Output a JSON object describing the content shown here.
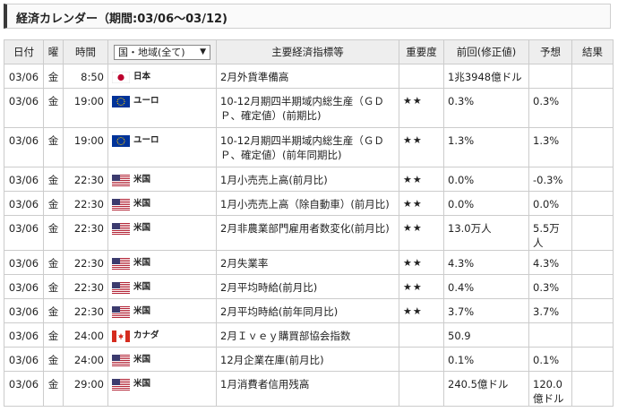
{
  "title": "経済カレンダー（期間:03/06〜03/12)",
  "headers": {
    "date": "日付",
    "day": "曜",
    "time": "時間",
    "region_select": "国・地域(全て)",
    "indicator": "主要経済指標等",
    "importance": "重要度",
    "previous": "前回(修正値)",
    "forecast": "予想",
    "result": "結果"
  },
  "rows": [
    {
      "date": "03/06",
      "day": "金",
      "time": "8:50",
      "flag": "jp-flag",
      "region": "日本",
      "indicator": "2月外貨準備高",
      "importance": "",
      "previous": "1兆3948億ドル",
      "forecast": "",
      "result": ""
    },
    {
      "date": "03/06",
      "day": "金",
      "time": "19:00",
      "flag": "eu-flag",
      "region": "ユーロ",
      "indicator": "10-12月期四半期域内総生産（ＧＤＰ、確定値）(前期比)",
      "importance": "★★",
      "previous": "0.3%",
      "forecast": "0.3%",
      "result": ""
    },
    {
      "date": "03/06",
      "day": "金",
      "time": "19:00",
      "flag": "eu-flag",
      "region": "ユーロ",
      "indicator": "10-12月期四半期域内総生産（ＧＤＰ、確定値）(前年同期比)",
      "importance": "★★",
      "previous": "1.3%",
      "forecast": "1.3%",
      "result": ""
    },
    {
      "date": "03/06",
      "day": "金",
      "time": "22:30",
      "flag": "us-flag",
      "region": "米国",
      "indicator": "1月小売売上高(前月比)",
      "importance": "★★",
      "previous": "0.0%",
      "forecast": "-0.3%",
      "result": ""
    },
    {
      "date": "03/06",
      "day": "金",
      "time": "22:30",
      "flag": "us-flag",
      "region": "米国",
      "indicator": "1月小売売上高（除自動車）(前月比)",
      "importance": "★★",
      "previous": "0.0%",
      "forecast": "0.0%",
      "result": ""
    },
    {
      "date": "03/06",
      "day": "金",
      "time": "22:30",
      "flag": "us-flag",
      "region": "米国",
      "indicator": "2月非農業部門雇用者数変化(前月比)",
      "importance": "★★",
      "previous": "13.0万人",
      "forecast": "5.5万人",
      "result": ""
    },
    {
      "date": "03/06",
      "day": "金",
      "time": "22:30",
      "flag": "us-flag",
      "region": "米国",
      "indicator": "2月失業率",
      "importance": "★★",
      "previous": "4.3%",
      "forecast": "4.3%",
      "result": ""
    },
    {
      "date": "03/06",
      "day": "金",
      "time": "22:30",
      "flag": "us-flag",
      "region": "米国",
      "indicator": "2月平均時給(前月比)",
      "importance": "★★",
      "previous": "0.4%",
      "forecast": "0.3%",
      "result": ""
    },
    {
      "date": "03/06",
      "day": "金",
      "time": "22:30",
      "flag": "us-flag",
      "region": "米国",
      "indicator": "2月平均時給(前年同月比)",
      "importance": "★★",
      "previous": "3.7%",
      "forecast": "3.7%",
      "result": ""
    },
    {
      "date": "03/06",
      "day": "金",
      "time": "24:00",
      "flag": "ca-flag",
      "region": "カナダ",
      "indicator": "2月Ｉｖｅｙ購買部協会指数",
      "importance": "",
      "previous": "50.9",
      "forecast": "",
      "result": ""
    },
    {
      "date": "03/06",
      "day": "金",
      "time": "24:00",
      "flag": "us-flag",
      "region": "米国",
      "indicator": "12月企業在庫(前月比)",
      "importance": "",
      "previous": "0.1%",
      "forecast": "0.1%",
      "result": ""
    },
    {
      "date": "03/06",
      "day": "金",
      "time": "29:00",
      "flag": "us-flag",
      "region": "米国",
      "indicator": "1月消費者信用残高",
      "importance": "",
      "previous": "240.5億ドル",
      "forecast": "120.0億ドル",
      "result": ""
    }
  ]
}
